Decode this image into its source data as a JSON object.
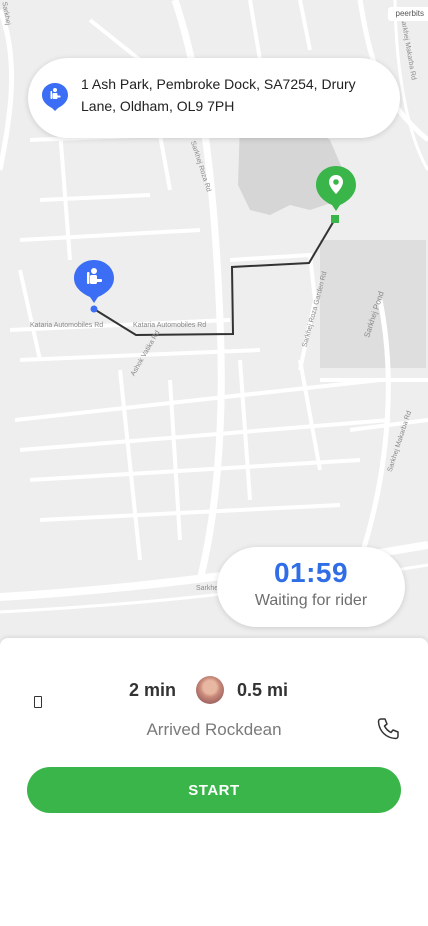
{
  "map": {
    "brand": "peerbits",
    "street_labels": [
      "Kataria Automobiles Rd",
      "Kataria Automobiles Rd",
      "Sarkhej Roza Rd",
      "Sarkhej Roza Garden Rd",
      "Sarkhej Pond",
      "Sarkhej Makarba Rd",
      "Sarkhej Makarba Rd",
      "Ashok Vatika Rd",
      "Sarkhej",
      "Sarkhe"
    ],
    "pickup_icon": "rider-pickup-pin-icon",
    "destination_icon": "location-pin-icon",
    "route_color": "#333333"
  },
  "address_card": {
    "icon": "rider-pickup-icon",
    "address": "1 Ash Park, Pembroke Dock, SA7254, Drury Lane, Oldham, OL9 7PH"
  },
  "timer": {
    "value": "01:59",
    "status": "Waiting for rider"
  },
  "trip": {
    "eta": "2 min",
    "distance": "0.5 mi",
    "status": "Arrived Rockdean",
    "avatar": "rider-avatar",
    "call_icon": "phone-icon",
    "left_icon": "missing-glyph-icon"
  },
  "action": {
    "start_label": "START"
  },
  "colors": {
    "accent_blue": "#2f6ee6",
    "pickup_blue": "#3b6ef5",
    "destination_green": "#3ab54a",
    "start_button": "#3ab54a"
  }
}
